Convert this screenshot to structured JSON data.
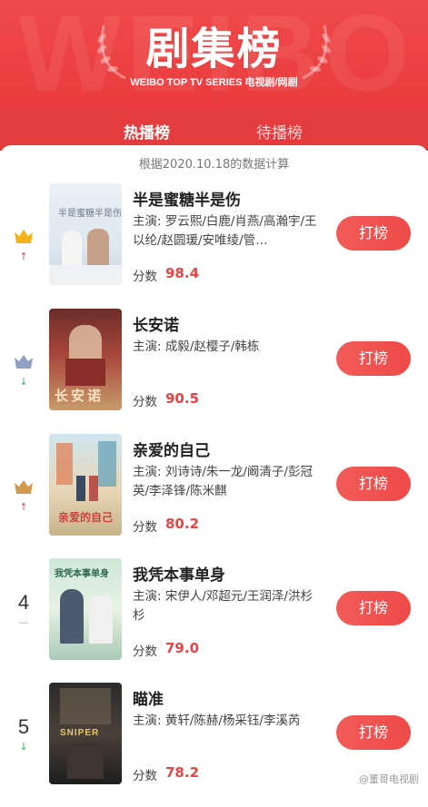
{
  "header": {
    "bg_text": "WEIBO",
    "title": "剧集榜",
    "subtitle": "WEIBO TOP TV SERIES 电视剧/网剧"
  },
  "tabs": [
    {
      "label": "热播榜",
      "active": true
    },
    {
      "label": "待播榜",
      "active": false
    }
  ],
  "date_note": "根据2020.10.18的数据计算",
  "score_label": "分数",
  "vote_label": "打榜",
  "watermark": "@董哥电视剧",
  "colors": {
    "brand": "#e93b3d",
    "up": "#e94444",
    "down": "#37b55a",
    "gold": "#f3b21c",
    "silver": "#8fa0c2",
    "bronze": "#d39a4f"
  },
  "items": [
    {
      "rank": "1",
      "trend": "↑",
      "trend_type": "up",
      "badge": "gold",
      "title": "半是蜜糖半是伤",
      "cast": "主演: 罗云熙/白鹿/肖燕/高瀚宇/王以纶/赵圆瑗/安唯绫/管…",
      "score": "98.4",
      "poster_text": "半是蜜糖半是伤"
    },
    {
      "rank": "2",
      "trend": "↓",
      "trend_type": "down",
      "badge": "silver",
      "title": "长安诺",
      "cast": "主演: 成毅/赵樱子/韩栋",
      "score": "90.5",
      "poster_text": "长安诺"
    },
    {
      "rank": "3",
      "trend": "↑",
      "trend_type": "up",
      "badge": "bronze",
      "title": "亲爱的自己",
      "cast": "主演: 刘诗诗/朱一龙/阚清子/彭冠英/李泽锋/陈米麒",
      "score": "80.2",
      "poster_text": "亲爱的自己"
    },
    {
      "rank": "4",
      "trend": "—",
      "trend_type": "flat",
      "badge": "",
      "title": "我凭本事单身",
      "cast": "主演: 宋伊人/邓超元/王润泽/洪杉杉",
      "score": "79.0",
      "poster_text": "我凭本事单身"
    },
    {
      "rank": "5",
      "trend": "↓",
      "trend_type": "down",
      "badge": "",
      "title": "瞄准",
      "cast": "主演: 黄轩/陈赫/杨采钰/李溪芮",
      "score": "78.2",
      "poster_text": "SNIPER"
    }
  ]
}
